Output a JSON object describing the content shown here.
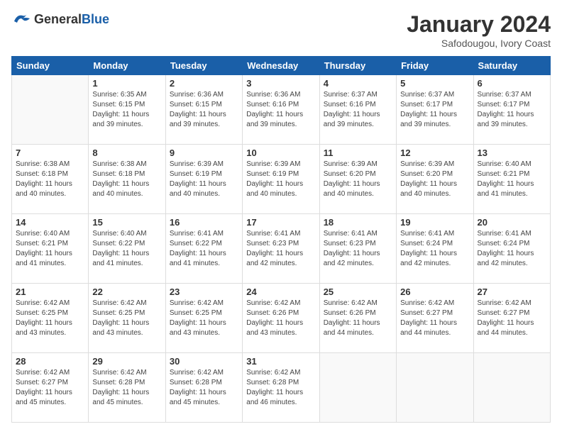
{
  "header": {
    "logo_general": "General",
    "logo_blue": "Blue",
    "title": "January 2024",
    "location": "Safodougou, Ivory Coast"
  },
  "days_of_week": [
    "Sunday",
    "Monday",
    "Tuesday",
    "Wednesday",
    "Thursday",
    "Friday",
    "Saturday"
  ],
  "weeks": [
    [
      {
        "day": "",
        "info": ""
      },
      {
        "day": "1",
        "info": "Sunrise: 6:35 AM\nSunset: 6:15 PM\nDaylight: 11 hours\nand 39 minutes."
      },
      {
        "day": "2",
        "info": "Sunrise: 6:36 AM\nSunset: 6:15 PM\nDaylight: 11 hours\nand 39 minutes."
      },
      {
        "day": "3",
        "info": "Sunrise: 6:36 AM\nSunset: 6:16 PM\nDaylight: 11 hours\nand 39 minutes."
      },
      {
        "day": "4",
        "info": "Sunrise: 6:37 AM\nSunset: 6:16 PM\nDaylight: 11 hours\nand 39 minutes."
      },
      {
        "day": "5",
        "info": "Sunrise: 6:37 AM\nSunset: 6:17 PM\nDaylight: 11 hours\nand 39 minutes."
      },
      {
        "day": "6",
        "info": "Sunrise: 6:37 AM\nSunset: 6:17 PM\nDaylight: 11 hours\nand 39 minutes."
      }
    ],
    [
      {
        "day": "7",
        "info": "Sunrise: 6:38 AM\nSunset: 6:18 PM\nDaylight: 11 hours\nand 40 minutes."
      },
      {
        "day": "8",
        "info": "Sunrise: 6:38 AM\nSunset: 6:18 PM\nDaylight: 11 hours\nand 40 minutes."
      },
      {
        "day": "9",
        "info": "Sunrise: 6:39 AM\nSunset: 6:19 PM\nDaylight: 11 hours\nand 40 minutes."
      },
      {
        "day": "10",
        "info": "Sunrise: 6:39 AM\nSunset: 6:19 PM\nDaylight: 11 hours\nand 40 minutes."
      },
      {
        "day": "11",
        "info": "Sunrise: 6:39 AM\nSunset: 6:20 PM\nDaylight: 11 hours\nand 40 minutes."
      },
      {
        "day": "12",
        "info": "Sunrise: 6:39 AM\nSunset: 6:20 PM\nDaylight: 11 hours\nand 40 minutes."
      },
      {
        "day": "13",
        "info": "Sunrise: 6:40 AM\nSunset: 6:21 PM\nDaylight: 11 hours\nand 41 minutes."
      }
    ],
    [
      {
        "day": "14",
        "info": "Sunrise: 6:40 AM\nSunset: 6:21 PM\nDaylight: 11 hours\nand 41 minutes."
      },
      {
        "day": "15",
        "info": "Sunrise: 6:40 AM\nSunset: 6:22 PM\nDaylight: 11 hours\nand 41 minutes."
      },
      {
        "day": "16",
        "info": "Sunrise: 6:41 AM\nSunset: 6:22 PM\nDaylight: 11 hours\nand 41 minutes."
      },
      {
        "day": "17",
        "info": "Sunrise: 6:41 AM\nSunset: 6:23 PM\nDaylight: 11 hours\nand 42 minutes."
      },
      {
        "day": "18",
        "info": "Sunrise: 6:41 AM\nSunset: 6:23 PM\nDaylight: 11 hours\nand 42 minutes."
      },
      {
        "day": "19",
        "info": "Sunrise: 6:41 AM\nSunset: 6:24 PM\nDaylight: 11 hours\nand 42 minutes."
      },
      {
        "day": "20",
        "info": "Sunrise: 6:41 AM\nSunset: 6:24 PM\nDaylight: 11 hours\nand 42 minutes."
      }
    ],
    [
      {
        "day": "21",
        "info": "Sunrise: 6:42 AM\nSunset: 6:25 PM\nDaylight: 11 hours\nand 43 minutes."
      },
      {
        "day": "22",
        "info": "Sunrise: 6:42 AM\nSunset: 6:25 PM\nDaylight: 11 hours\nand 43 minutes."
      },
      {
        "day": "23",
        "info": "Sunrise: 6:42 AM\nSunset: 6:25 PM\nDaylight: 11 hours\nand 43 minutes."
      },
      {
        "day": "24",
        "info": "Sunrise: 6:42 AM\nSunset: 6:26 PM\nDaylight: 11 hours\nand 43 minutes."
      },
      {
        "day": "25",
        "info": "Sunrise: 6:42 AM\nSunset: 6:26 PM\nDaylight: 11 hours\nand 44 minutes."
      },
      {
        "day": "26",
        "info": "Sunrise: 6:42 AM\nSunset: 6:27 PM\nDaylight: 11 hours\nand 44 minutes."
      },
      {
        "day": "27",
        "info": "Sunrise: 6:42 AM\nSunset: 6:27 PM\nDaylight: 11 hours\nand 44 minutes."
      }
    ],
    [
      {
        "day": "28",
        "info": "Sunrise: 6:42 AM\nSunset: 6:27 PM\nDaylight: 11 hours\nand 45 minutes."
      },
      {
        "day": "29",
        "info": "Sunrise: 6:42 AM\nSunset: 6:28 PM\nDaylight: 11 hours\nand 45 minutes."
      },
      {
        "day": "30",
        "info": "Sunrise: 6:42 AM\nSunset: 6:28 PM\nDaylight: 11 hours\nand 45 minutes."
      },
      {
        "day": "31",
        "info": "Sunrise: 6:42 AM\nSunset: 6:28 PM\nDaylight: 11 hours\nand 46 minutes."
      },
      {
        "day": "",
        "info": ""
      },
      {
        "day": "",
        "info": ""
      },
      {
        "day": "",
        "info": ""
      }
    ]
  ]
}
